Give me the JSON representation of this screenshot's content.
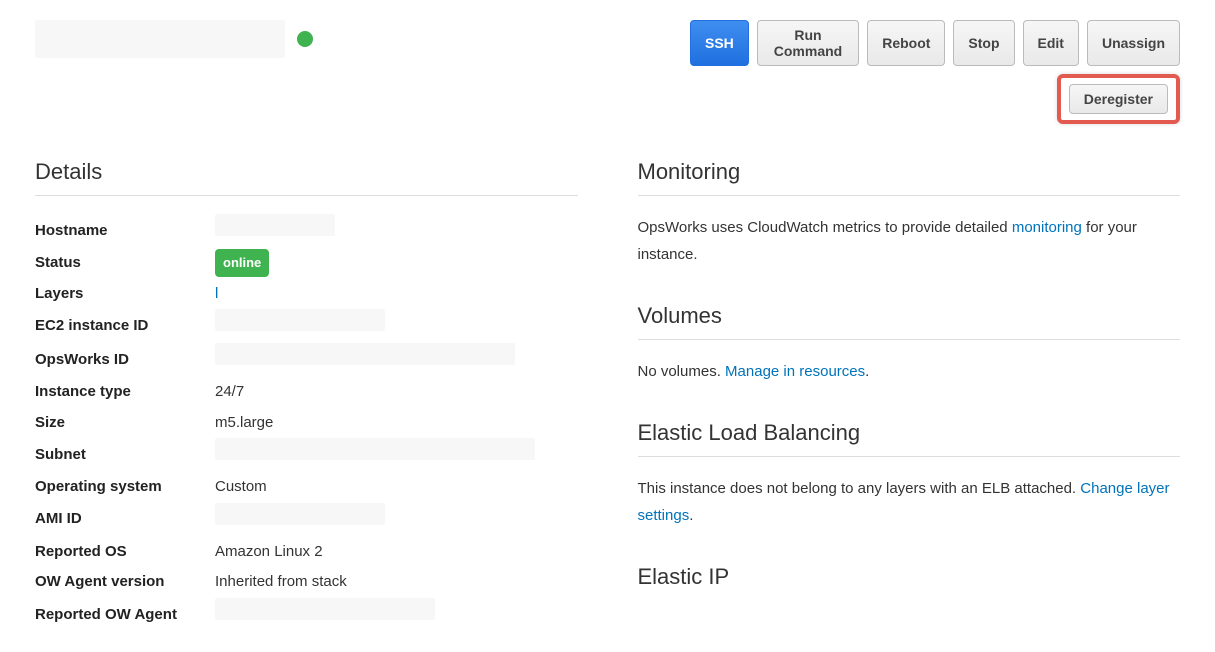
{
  "header": {
    "status_indicator": "online"
  },
  "actions": {
    "ssh": "SSH",
    "run_command": "Run Command",
    "reboot": "Reboot",
    "stop": "Stop",
    "edit": "Edit",
    "unassign": "Unassign",
    "deregister": "Deregister"
  },
  "details": {
    "heading": "Details",
    "rows": {
      "hostname_label": "Hostname",
      "status_label": "Status",
      "status_value": "online",
      "layers_label": "Layers",
      "layers_value": "l",
      "ec2_instance_id_label": "EC2 instance ID",
      "opsworks_id_label": "OpsWorks ID",
      "instance_type_label": "Instance type",
      "instance_type_value": "24/7",
      "size_label": "Size",
      "size_value": "m5.large",
      "subnet_label": "Subnet",
      "operating_system_label": "Operating system",
      "operating_system_value": "Custom",
      "ami_id_label": "AMI ID",
      "reported_os_label": "Reported OS",
      "reported_os_value": "Amazon Linux 2",
      "ow_agent_version_label": "OW Agent version",
      "ow_agent_version_value": "Inherited from stack",
      "reported_ow_agent_label": "Reported OW Agent"
    }
  },
  "monitoring": {
    "heading": "Monitoring",
    "body_pre": "OpsWorks uses CloudWatch metrics to provide detailed ",
    "body_link": "monitoring",
    "body_post": " for your instance."
  },
  "volumes": {
    "heading": "Volumes",
    "body_pre": "No volumes. ",
    "body_link": "Manage in resources",
    "body_post": "."
  },
  "elb": {
    "heading": "Elastic Load Balancing",
    "body_pre": "This instance does not belong to any layers with an ELB attached. ",
    "body_link": "Change layer settings",
    "body_post": "."
  },
  "eip": {
    "heading": "Elastic IP"
  }
}
